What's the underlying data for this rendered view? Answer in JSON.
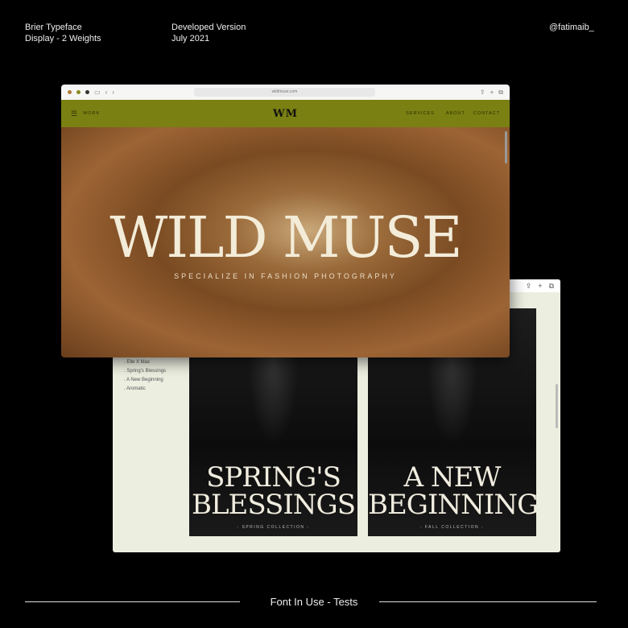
{
  "header": {
    "typeface": "Brier Typeface",
    "weights": "Display - 2 Weights",
    "version": "Developed Version",
    "date": "July 2021",
    "handle": "@fatimaib_"
  },
  "front": {
    "url": "wildmuse.com",
    "nav_left": "WORK",
    "logo": "WM",
    "nav_right": [
      "SERVICES",
      "ABOUT",
      "CONTACT"
    ],
    "title": "WILD MUSE",
    "subtitle": "SPECIALIZE IN FASHION PHOTOGRAPHY",
    "nav_color": "#7a8012"
  },
  "back": {
    "side_items": [
      "Elle X Max",
      "Spring's Blessings",
      "A New Beginning",
      "Aromatic"
    ],
    "cards": [
      {
        "title": "SPRING'S BLESSINGS",
        "sub": "- SPRING COLLECTION -"
      },
      {
        "title": "A NEW BEGINNING",
        "sub": "- FALL COLLECTION -"
      }
    ]
  },
  "footer": "Font In Use - Tests"
}
